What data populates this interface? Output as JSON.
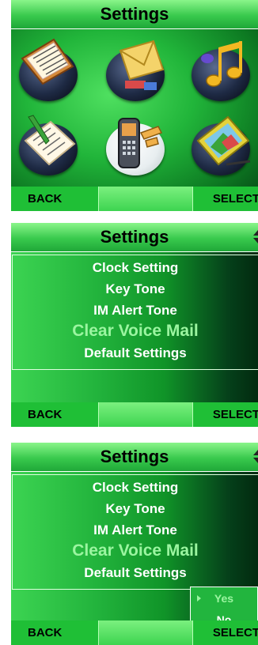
{
  "screen1": {
    "title": "Settings",
    "softkeys": {
      "left": "BACK",
      "right": "SELECT"
    },
    "icons": [
      "address-book-icon",
      "envelope-icon",
      "music-note-icon",
      "notepad-icon",
      "phone-handset-icon",
      "photo-album-icon"
    ]
  },
  "screen2": {
    "title": "Settings",
    "items": [
      "Clock Setting",
      "Key Tone",
      "IM Alert Tone",
      "Clear Voice Mail",
      "Default Settings"
    ],
    "selected_index": 3,
    "softkeys": {
      "left": "BACK",
      "right": "SELECT"
    }
  },
  "screen3": {
    "title": "Settings",
    "items": [
      "Clock Setting",
      "Key Tone",
      "IM Alert Tone",
      "Clear Voice Mail",
      "Default Settings"
    ],
    "selected_index": 3,
    "popup": {
      "yes": "Yes",
      "no": "No",
      "selected": "Yes"
    },
    "softkeys": {
      "left": "BACK",
      "right": "SELECT"
    }
  }
}
